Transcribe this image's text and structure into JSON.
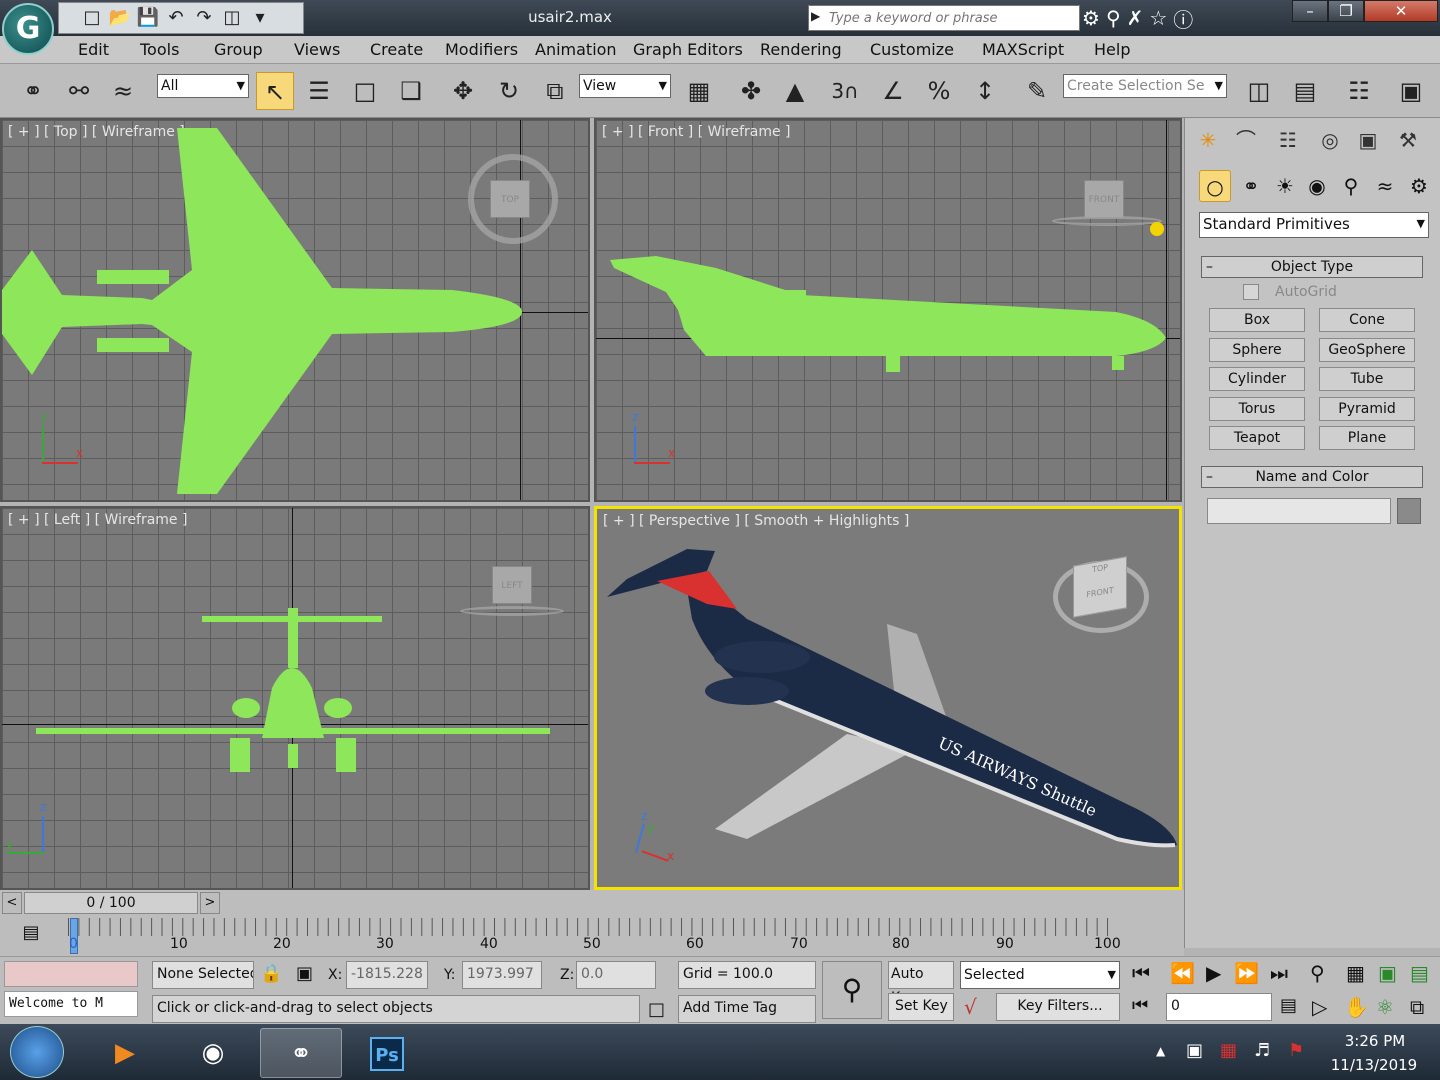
{
  "app": {
    "title": "usair2.max",
    "logo": "G"
  },
  "search": {
    "placeholder": "Type a keyword or phrase"
  },
  "menu": [
    "Edit",
    "Tools",
    "Group",
    "Views",
    "Create",
    "Modifiers",
    "Animation",
    "Graph Editors",
    "Rendering",
    "Customize",
    "MAXScript",
    "Help"
  ],
  "toolbar": {
    "filter_value": "All",
    "ref_coord_value": "View",
    "snap_label": "3",
    "selection_set_placeholder": "Create Selection Se"
  },
  "viewports": {
    "top": {
      "label": "[ + ] [ Top ] [ Wireframe ]",
      "cube": "TOP"
    },
    "front": {
      "label": "[ + ] [ Front ] [ Wireframe ]",
      "cube": "FRONT"
    },
    "left": {
      "label": "[ + ] [ Left ] [ Wireframe ]",
      "cube": "LEFT"
    },
    "perspective": {
      "label": "[ + ] [ Perspective ] [ Smooth + Highlights ]",
      "cube_top": "TOP",
      "cube_front": "FRONT",
      "livery": "US AIRWAYS Shuttle"
    },
    "axis": {
      "x": "x",
      "y": "y",
      "z": "z"
    }
  },
  "command_panel": {
    "category_value": "Standard Primitives",
    "object_type_title": "Object Type",
    "autogrid_label": "AutoGrid",
    "primitives": [
      "Box",
      "Cone",
      "Sphere",
      "GeoSphere",
      "Cylinder",
      "Tube",
      "Torus",
      "Pyramid",
      "Teapot",
      "Plane"
    ],
    "name_color_title": "Name and Color",
    "name_value": "",
    "color": "#8a8a8a"
  },
  "timeline": {
    "frame_display": "0 / 100",
    "ticks": [
      "0",
      "10",
      "20",
      "30",
      "40",
      "50",
      "60",
      "70",
      "80",
      "90",
      "100"
    ]
  },
  "status": {
    "selection": "None Selected",
    "x_label": "X:",
    "x_value": "-1815.228",
    "y_label": "Y:",
    "y_value": "1973.997",
    "z_label": "Z:",
    "z_value": "0.0",
    "grid": "Grid = 100.0",
    "auto_key": "Auto Key",
    "key_mode": "Selected",
    "set_key": "Set Key",
    "key_filters": "Key Filters...",
    "frame_value": "0",
    "maxscript_text": "Welcome to M",
    "prompt": "Click or click-and-drag to select objects",
    "add_time_tag": "Add Time Tag"
  },
  "taskbar": {
    "time": "3:26 PM",
    "date": "11/13/2019",
    "ps_label": "Ps"
  },
  "colors": {
    "wire": "#8ee65a",
    "accent_yellow": "#f4e200",
    "fuselage": "#1b2a45",
    "tail_red": "#d8312f"
  }
}
